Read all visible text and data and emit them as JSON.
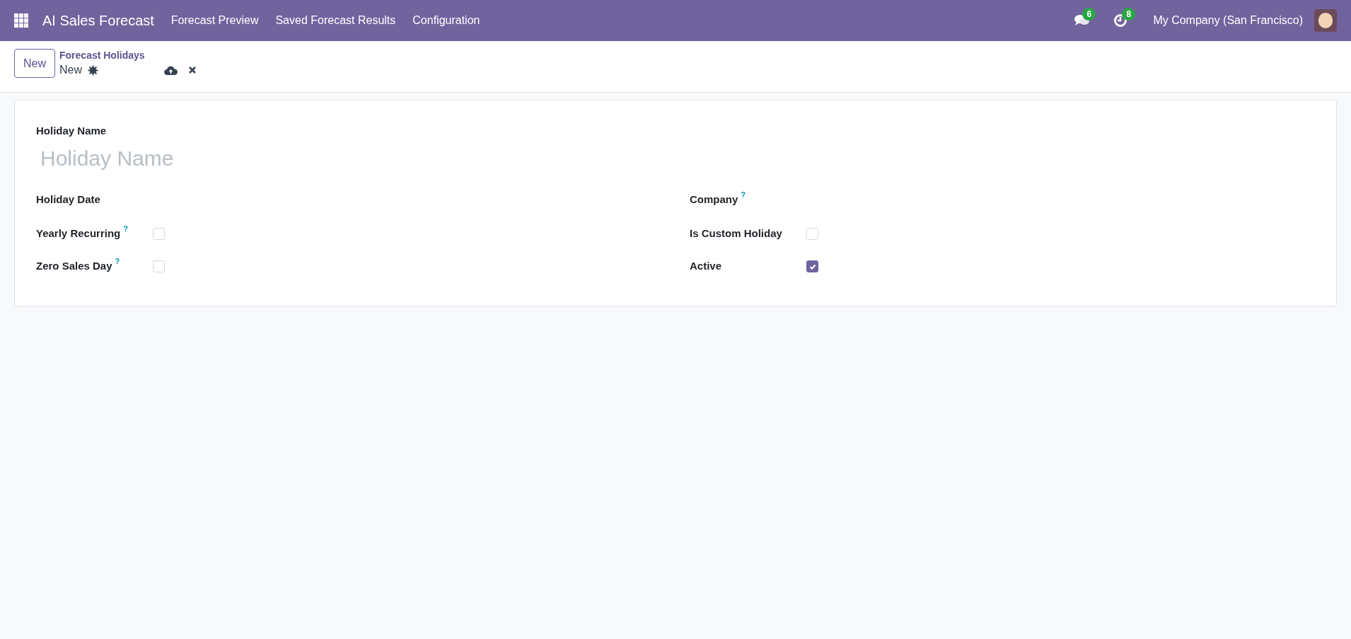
{
  "navbar": {
    "app_name": "AI Sales Forecast",
    "menu": [
      "Forecast Preview",
      "Saved Forecast Results",
      "Configuration"
    ],
    "messages_badge": "6",
    "activities_badge": "8",
    "company": "My Company (San Francisco)"
  },
  "control_panel": {
    "new_button": "New",
    "breadcrumb": "Forecast Holidays",
    "record": "New"
  },
  "form": {
    "name_label": "Holiday Name",
    "name_placeholder": "Holiday Name",
    "columns": [
      [
        {
          "kind": "field",
          "label": "Holiday Date"
        },
        {
          "kind": "checkbox",
          "label": "Yearly Recurring",
          "help": "?",
          "checked": false
        },
        {
          "kind": "checkbox",
          "label": "Zero Sales Day",
          "help": "?",
          "checked": false
        }
      ],
      [
        {
          "kind": "field",
          "label": "Company",
          "help": "?"
        },
        {
          "kind": "checkbox",
          "label": "Is Custom Holiday",
          "checked": false
        },
        {
          "kind": "checkbox",
          "label": "Active",
          "checked": true
        }
      ]
    ]
  }
}
